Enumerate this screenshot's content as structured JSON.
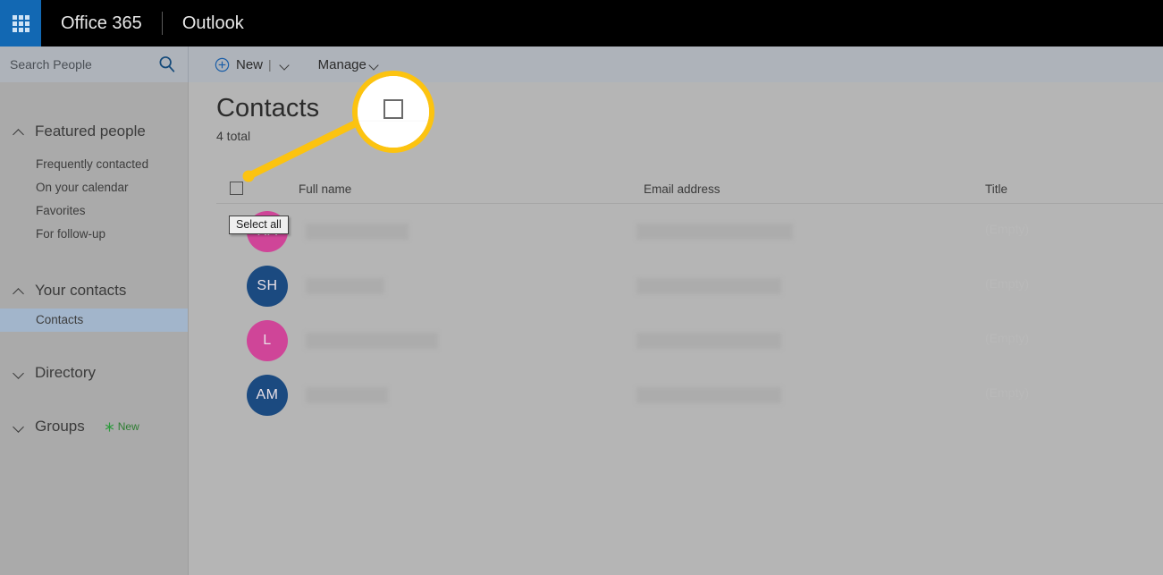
{
  "topbar": {
    "waffle_label": "app-launcher",
    "brand": "Office 365",
    "app": "Outlook"
  },
  "commandbar": {
    "search_placeholder": "Search People",
    "search_value": "",
    "new_label": "New",
    "new_separator": "|",
    "manage_label": "Manage"
  },
  "sidebar": {
    "groups": [
      {
        "label": "Featured people",
        "expanded": true,
        "items": [
          {
            "label": "Frequently contacted",
            "selected": false
          },
          {
            "label": "On your calendar",
            "selected": false
          },
          {
            "label": "Favorites",
            "selected": false
          },
          {
            "label": "For follow-up",
            "selected": false
          }
        ]
      },
      {
        "label": "Your contacts",
        "expanded": true,
        "items": [
          {
            "label": "Contacts",
            "selected": true
          }
        ]
      },
      {
        "label": "Directory",
        "expanded": false,
        "items": []
      },
      {
        "label": "Groups",
        "expanded": false,
        "badge": "New",
        "items": []
      }
    ]
  },
  "main": {
    "title": "Contacts",
    "count_text": "4 total",
    "table": {
      "columns": [
        "Full name",
        "Email address",
        "Title"
      ],
      "select_all_checked": false,
      "rows": [
        {
          "initials": "RA",
          "avatar_color": "#cf4598",
          "full_name": "",
          "email": "",
          "title": "(Empty)",
          "name_width": 115,
          "email_width": 175
        },
        {
          "initials": "SH",
          "avatar_color": "#1b4a80",
          "full_name": "",
          "email": "",
          "title": "(Empty)",
          "name_width": 88,
          "email_width": 162
        },
        {
          "initials": "L",
          "avatar_color": "#cf4598",
          "full_name": "",
          "email": "",
          "title": "(Empty)",
          "name_width": 148,
          "email_width": 162
        },
        {
          "initials": "AM",
          "avatar_color": "#1b4a80",
          "full_name": "",
          "email": "",
          "title": "(Empty)",
          "name_width": 92,
          "email_width": 162
        }
      ]
    }
  },
  "annotation": {
    "tooltip_text": "Select all",
    "callout_target": "select-all-checkbox",
    "highlight_color": "#fcc310"
  },
  "colors": {
    "topbar_bg": "#000000",
    "waffle_bg": "#1268b3",
    "commandbar_bg": "#aeb3ba",
    "sidebar_bg": "#aaaaaa",
    "main_bg": "#b5b5b5",
    "selected_item_bg": "#a2b5cb",
    "badge_green": "#2e7d32"
  }
}
